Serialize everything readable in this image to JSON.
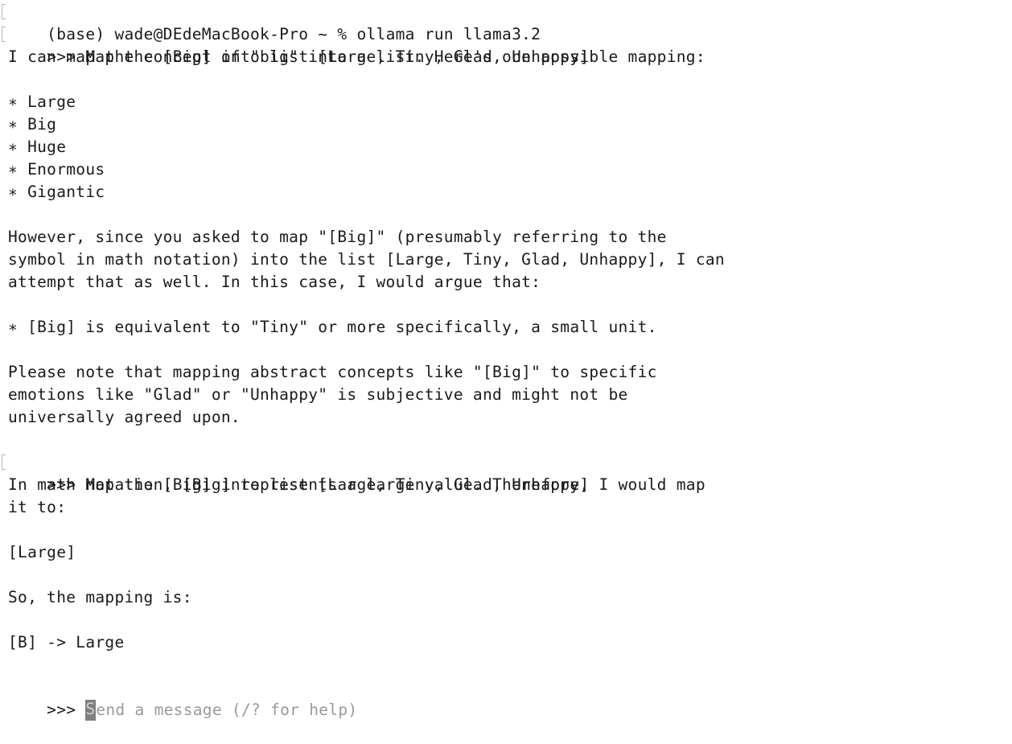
{
  "terminal": {
    "lines": {
      "l01": "(base) wade@DEdeMacBook-Pro ~ % ollama run llama3.2",
      "l02": ">>> Map the [Big] into list [Large, Tiny, Glad, Unhappy]",
      "l03": "I can map the concept of \"big\" into a list. Here's one possible mapping:",
      "l05": "∗ Large",
      "l06": "∗ Big",
      "l07": "∗ Huge",
      "l08": "∗ Enormous",
      "l09": "∗ Gigantic",
      "l11": "However, since you asked to map \"[Big]\" (presumably referring to the",
      "l12": "symbol in math notation) into the list [Large, Tiny, Glad, Unhappy], I can",
      "l13": "attempt that as well. In this case, I would argue that:",
      "l15": "∗ [Big] is equivalent to \"Tiny\" or more specifically, a small unit.",
      "l17": "Please note that mapping abstract concepts like \"[Big]\" to specific",
      "l18": "emotions like \"Glad\" or \"Unhappy\" is subjective and might not be",
      "l19": "universally agreed upon.",
      "l21": ">>> Map the [Big] into list [Large, Tiny, Glad, Unhappy]",
      "l22": "In math notation, [Big] represents a large value. Therefore, I would map",
      "l23": "it to:",
      "l25": "[Large]",
      "l27": "So, the mapping is:",
      "l29": "[B] -> Large"
    },
    "input": {
      "prompt": ">>> ",
      "placeholder_first_char": "S",
      "placeholder_rest": "end a message (/? for help)"
    }
  }
}
